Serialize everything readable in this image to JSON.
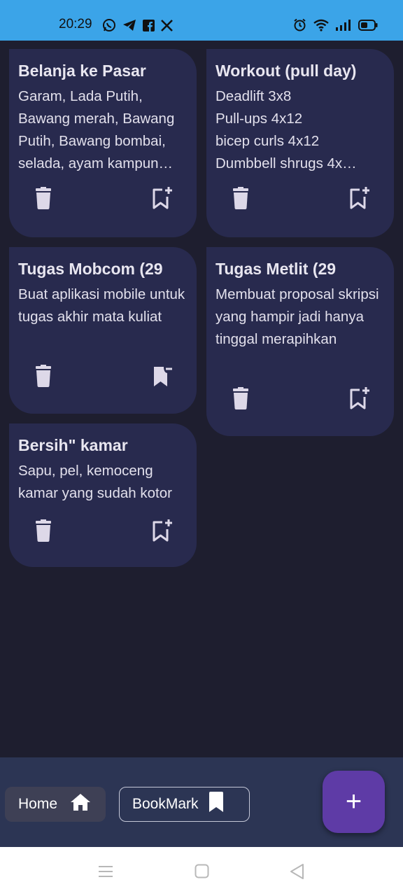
{
  "status_bar": {
    "time": "20:29",
    "left_icons": [
      "whatsapp-icon",
      "telegram-icon",
      "facebook-icon",
      "x-icon"
    ],
    "right_icons": [
      "alarm-icon",
      "wifi-icon",
      "signal-icon",
      "battery-icon"
    ]
  },
  "notes": [
    {
      "title": "Belanja ke Pasar",
      "body": "Garam, Lada Putih, Bawang merah, Bawang Putih, Bawang bombai, selada, ayam kampun…",
      "bookmarked": false
    },
    {
      "title": "Workout (pull day)",
      "body_lines": [
        "Deadlift 3x8",
        "Pull-ups 4x12",
        "bicep curls 4x12",
        "Dumbbell shrugs 4x…"
      ],
      "bookmarked": false
    },
    {
      "title": "Tugas Mobcom (29",
      "body": "Buat aplikasi mobile untuk tugas akhir mata kuliat",
      "bookmarked": true
    },
    {
      "title": "Tugas Metlit (29",
      "body": "Membuat proposal skripsi yang hampir jadi hanya tinggal merapihkan",
      "bookmarked": false
    },
    {
      "title": "Bersih\" kamar",
      "body": "Sapu, pel, kemoceng kamar yang sudah kotor",
      "bookmarked": false
    }
  ],
  "bottom_nav": {
    "home_label": "Home",
    "bookmark_label": "BookMark",
    "fab_label": "+"
  },
  "colors": {
    "status_bar": "#3ba4e8",
    "background": "#1e1e2f",
    "card": "#282a4e",
    "bottom_bar": "#2c3554",
    "fab": "#5e3ba6"
  }
}
